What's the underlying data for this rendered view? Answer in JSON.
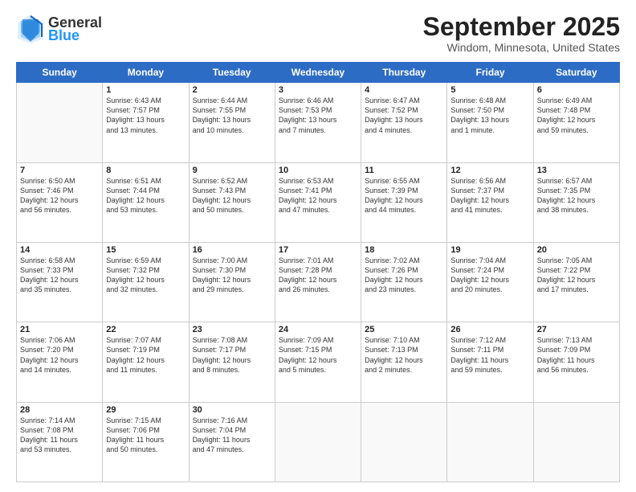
{
  "header": {
    "logo_general": "General",
    "logo_blue": "Blue",
    "title": "September 2025",
    "subtitle": "Windom, Minnesota, United States"
  },
  "weekdays": [
    "Sunday",
    "Monday",
    "Tuesday",
    "Wednesday",
    "Thursday",
    "Friday",
    "Saturday"
  ],
  "weeks": [
    [
      {
        "day": "",
        "info": ""
      },
      {
        "day": "1",
        "info": "Sunrise: 6:43 AM\nSunset: 7:57 PM\nDaylight: 13 hours\nand 13 minutes."
      },
      {
        "day": "2",
        "info": "Sunrise: 6:44 AM\nSunset: 7:55 PM\nDaylight: 13 hours\nand 10 minutes."
      },
      {
        "day": "3",
        "info": "Sunrise: 6:46 AM\nSunset: 7:53 PM\nDaylight: 13 hours\nand 7 minutes."
      },
      {
        "day": "4",
        "info": "Sunrise: 6:47 AM\nSunset: 7:52 PM\nDaylight: 13 hours\nand 4 minutes."
      },
      {
        "day": "5",
        "info": "Sunrise: 6:48 AM\nSunset: 7:50 PM\nDaylight: 13 hours\nand 1 minute."
      },
      {
        "day": "6",
        "info": "Sunrise: 6:49 AM\nSunset: 7:48 PM\nDaylight: 12 hours\nand 59 minutes."
      }
    ],
    [
      {
        "day": "7",
        "info": "Sunrise: 6:50 AM\nSunset: 7:46 PM\nDaylight: 12 hours\nand 56 minutes."
      },
      {
        "day": "8",
        "info": "Sunrise: 6:51 AM\nSunset: 7:44 PM\nDaylight: 12 hours\nand 53 minutes."
      },
      {
        "day": "9",
        "info": "Sunrise: 6:52 AM\nSunset: 7:43 PM\nDaylight: 12 hours\nand 50 minutes."
      },
      {
        "day": "10",
        "info": "Sunrise: 6:53 AM\nSunset: 7:41 PM\nDaylight: 12 hours\nand 47 minutes."
      },
      {
        "day": "11",
        "info": "Sunrise: 6:55 AM\nSunset: 7:39 PM\nDaylight: 12 hours\nand 44 minutes."
      },
      {
        "day": "12",
        "info": "Sunrise: 6:56 AM\nSunset: 7:37 PM\nDaylight: 12 hours\nand 41 minutes."
      },
      {
        "day": "13",
        "info": "Sunrise: 6:57 AM\nSunset: 7:35 PM\nDaylight: 12 hours\nand 38 minutes."
      }
    ],
    [
      {
        "day": "14",
        "info": "Sunrise: 6:58 AM\nSunset: 7:33 PM\nDaylight: 12 hours\nand 35 minutes."
      },
      {
        "day": "15",
        "info": "Sunrise: 6:59 AM\nSunset: 7:32 PM\nDaylight: 12 hours\nand 32 minutes."
      },
      {
        "day": "16",
        "info": "Sunrise: 7:00 AM\nSunset: 7:30 PM\nDaylight: 12 hours\nand 29 minutes."
      },
      {
        "day": "17",
        "info": "Sunrise: 7:01 AM\nSunset: 7:28 PM\nDaylight: 12 hours\nand 26 minutes."
      },
      {
        "day": "18",
        "info": "Sunrise: 7:02 AM\nSunset: 7:26 PM\nDaylight: 12 hours\nand 23 minutes."
      },
      {
        "day": "19",
        "info": "Sunrise: 7:04 AM\nSunset: 7:24 PM\nDaylight: 12 hours\nand 20 minutes."
      },
      {
        "day": "20",
        "info": "Sunrise: 7:05 AM\nSunset: 7:22 PM\nDaylight: 12 hours\nand 17 minutes."
      }
    ],
    [
      {
        "day": "21",
        "info": "Sunrise: 7:06 AM\nSunset: 7:20 PM\nDaylight: 12 hours\nand 14 minutes."
      },
      {
        "day": "22",
        "info": "Sunrise: 7:07 AM\nSunset: 7:19 PM\nDaylight: 12 hours\nand 11 minutes."
      },
      {
        "day": "23",
        "info": "Sunrise: 7:08 AM\nSunset: 7:17 PM\nDaylight: 12 hours\nand 8 minutes."
      },
      {
        "day": "24",
        "info": "Sunrise: 7:09 AM\nSunset: 7:15 PM\nDaylight: 12 hours\nand 5 minutes."
      },
      {
        "day": "25",
        "info": "Sunrise: 7:10 AM\nSunset: 7:13 PM\nDaylight: 12 hours\nand 2 minutes."
      },
      {
        "day": "26",
        "info": "Sunrise: 7:12 AM\nSunset: 7:11 PM\nDaylight: 11 hours\nand 59 minutes."
      },
      {
        "day": "27",
        "info": "Sunrise: 7:13 AM\nSunset: 7:09 PM\nDaylight: 11 hours\nand 56 minutes."
      }
    ],
    [
      {
        "day": "28",
        "info": "Sunrise: 7:14 AM\nSunset: 7:08 PM\nDaylight: 11 hours\nand 53 minutes."
      },
      {
        "day": "29",
        "info": "Sunrise: 7:15 AM\nSunset: 7:06 PM\nDaylight: 11 hours\nand 50 minutes."
      },
      {
        "day": "30",
        "info": "Sunrise: 7:16 AM\nSunset: 7:04 PM\nDaylight: 11 hours\nand 47 minutes."
      },
      {
        "day": "",
        "info": ""
      },
      {
        "day": "",
        "info": ""
      },
      {
        "day": "",
        "info": ""
      },
      {
        "day": "",
        "info": ""
      }
    ]
  ]
}
